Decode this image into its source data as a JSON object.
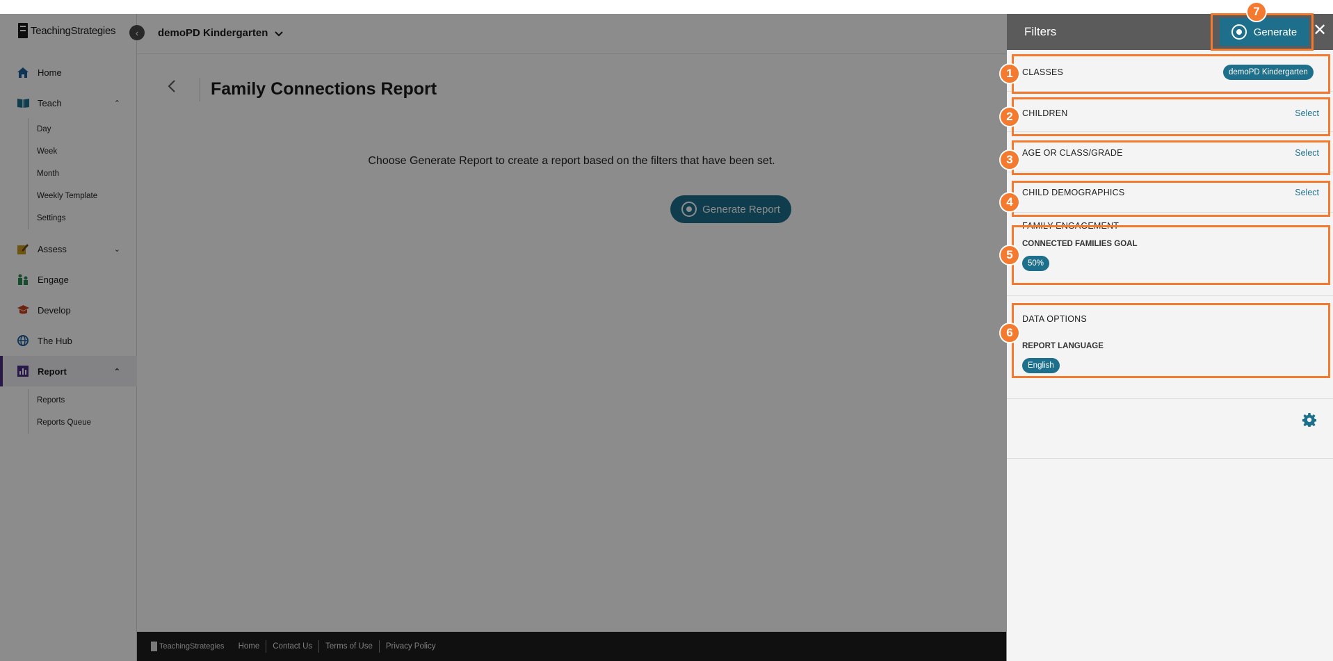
{
  "brand": {
    "name": "TeachingStrategies"
  },
  "header": {
    "class_name": "demoPD Kindergarten"
  },
  "sidebar": {
    "items": [
      {
        "label": "Home",
        "icon": "home-icon"
      },
      {
        "label": "Teach",
        "icon": "book-icon"
      },
      {
        "label": "Assess",
        "icon": "assess-icon"
      },
      {
        "label": "Engage",
        "icon": "engage-icon"
      },
      {
        "label": "Develop",
        "icon": "graduation-cap-icon"
      },
      {
        "label": "The Hub",
        "icon": "globe-icon"
      },
      {
        "label": "Report",
        "icon": "bar-chart-icon"
      }
    ],
    "teach_sub": [
      "Day",
      "Week",
      "Month",
      "Weekly Template",
      "Settings"
    ],
    "report_sub": [
      "Reports",
      "Reports Queue"
    ]
  },
  "main": {
    "title": "Family Connections Report",
    "instruction": "Choose Generate Report to create a report based on the filters that have been set.",
    "generate_label": "Generate Report"
  },
  "footer": {
    "brand": "TeachingStrategies",
    "links": [
      "Home",
      "Contact Us",
      "Terms of Use",
      "Privacy Policy"
    ]
  },
  "filters": {
    "title": "Filters",
    "generate_label": "Generate",
    "classes": {
      "label": "CLASSES",
      "value": "demoPD Kindergarten"
    },
    "children": {
      "label": "CHILDREN",
      "action": "Select"
    },
    "age": {
      "label": "AGE OR CLASS/GRADE",
      "action": "Select"
    },
    "demographics": {
      "label": "CHILD DEMOGRAPHICS",
      "action": "Select"
    },
    "family": {
      "label": "FAMILY ENGAGEMENT",
      "sub_label": "CONNECTED FAMILIES GOAL",
      "value": "50%"
    },
    "data_options": {
      "label": "DATA OPTIONS",
      "sub_label": "REPORT LANGUAGE",
      "value": "English"
    }
  },
  "annotations": [
    "1",
    "2",
    "3",
    "4",
    "5",
    "6",
    "7"
  ],
  "colors": {
    "accent": "#1d6f8c",
    "annotation": "#f47a30",
    "active_nav": "#4b2e83"
  }
}
